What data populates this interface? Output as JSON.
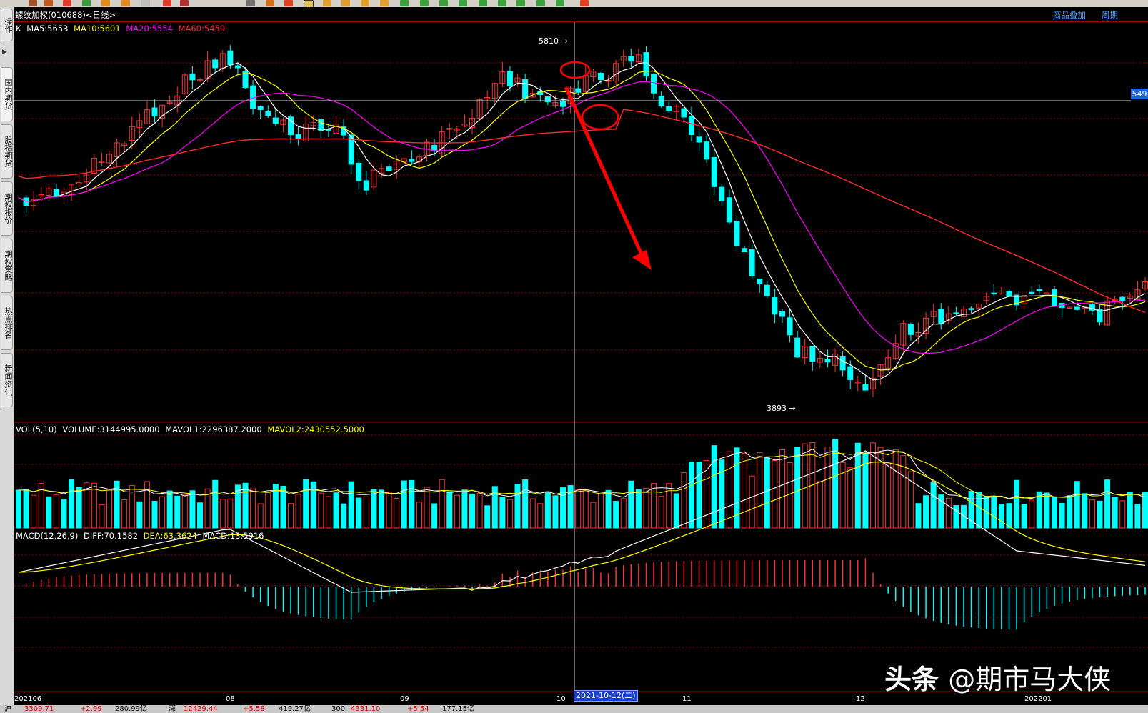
{
  "window": {
    "title": "螺纹加权(010688)<日线>",
    "links": [
      "商品叠加",
      "周期"
    ]
  },
  "sidebar": {
    "tabs": [
      "操作",
      "国内期货",
      "股指期货",
      "期权报价",
      "期权策略",
      "热点排名",
      "新闻资讯"
    ]
  },
  "main_legend": {
    "k": "K",
    "ma5": "MA5:5653",
    "ma10": "MA10:5601",
    "ma20": "MA20:5554",
    "ma60": "MA60:5459"
  },
  "vol_legend": {
    "name": "VOL(5,10)",
    "volume": "VOLUME:3144995.0000",
    "mavol1": "MAVOL1:2296387.2000",
    "mavol2": "MAVOL2:2430552.5000"
  },
  "macd_legend": {
    "name": "MACD(12,26,9)",
    "diff": "DIFF:70.1582",
    "dea": "DEA:63.3624",
    "macd": "MACD:13.5916"
  },
  "markers": {
    "high": "5810",
    "low": "3893",
    "crosshair_price": "549",
    "crosshair_date": "2021-10-12(二)"
  },
  "x_axis": [
    "202106",
    "08",
    "09",
    "10",
    "11",
    "12",
    "202201"
  ],
  "status_bar": {
    "sh_label": "沪",
    "sh_index": "3309.71",
    "sh_change": "+2.99",
    "sh_amount": "280.99亿",
    "sz_label": "深",
    "sz_index": "12429.44",
    "sz_change": "+5.58",
    "sz_amount": "419.27亿",
    "hs300_label": "300",
    "hs300_index": "4331.10",
    "hs300_change": "+5.54",
    "hs300_amount": "177.15亿"
  },
  "watermark": {
    "brand": "头条",
    "account": "@期市马大侠"
  },
  "colors": {
    "up": "#ff3232",
    "down": "#00ffff",
    "ma5": "#ffffff",
    "ma10": "#ffff00",
    "ma20": "#ff00ff",
    "ma60": "#ff2a2a",
    "grid": "#8b0000",
    "annotation": "#ff0000"
  }
}
